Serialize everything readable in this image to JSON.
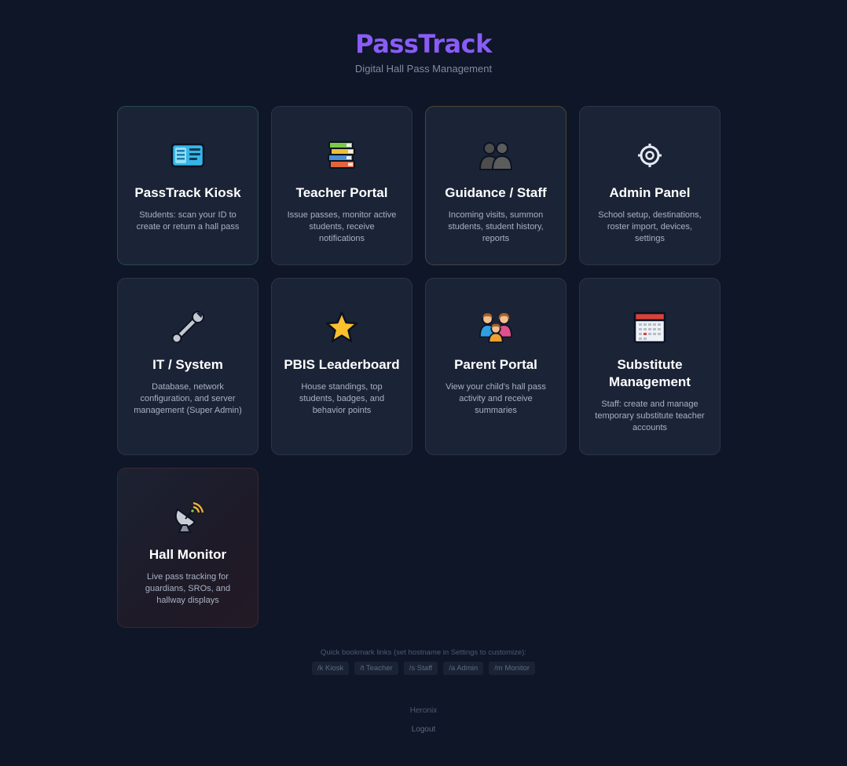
{
  "header": {
    "title": "PassTrack",
    "subtitle": "Digital Hall Pass Management"
  },
  "cards": [
    {
      "title": "PassTrack Kiosk",
      "description": "Students: scan your ID to create or return a hall pass",
      "icon": "id-card-icon"
    },
    {
      "title": "Teacher Portal",
      "description": "Issue passes, monitor active students, receive notifications",
      "icon": "books-icon"
    },
    {
      "title": "Guidance / Staff",
      "description": "Incoming visits, summon students, student history, reports",
      "icon": "people-icon"
    },
    {
      "title": "Admin Panel",
      "description": "School setup, destinations, roster import, devices, settings",
      "icon": "gear-icon"
    },
    {
      "title": "IT / System",
      "description": "Database, network configuration, and server management (Super Admin)",
      "icon": "wrench-icon"
    },
    {
      "title": "PBIS Leaderboard",
      "description": "House standings, top students, badges, and behavior points",
      "icon": "star-icon"
    },
    {
      "title": "Parent Portal",
      "description": "View your child's hall pass activity and receive summaries",
      "icon": "family-icon"
    },
    {
      "title": "Substitute Management",
      "description": "Staff: create and manage temporary substitute teacher accounts",
      "icon": "calendar-icon"
    },
    {
      "title": "Hall Monitor",
      "description": "Live pass tracking for guardians, SROs, and hallway displays",
      "icon": "satellite-dish-icon"
    }
  ],
  "bookmarks": {
    "note": "Quick bookmark links (set hostname in Settings to customize):",
    "links": [
      "/k Kiosk",
      "/t Teacher",
      "/s Staff",
      "/a Admin",
      "/m Monitor"
    ]
  },
  "footer": {
    "brand": "Heronix",
    "logout": "Logout"
  },
  "colors": {
    "background": "#0e1628",
    "card": "#1b2436",
    "accent": "#8a5cf6"
  }
}
